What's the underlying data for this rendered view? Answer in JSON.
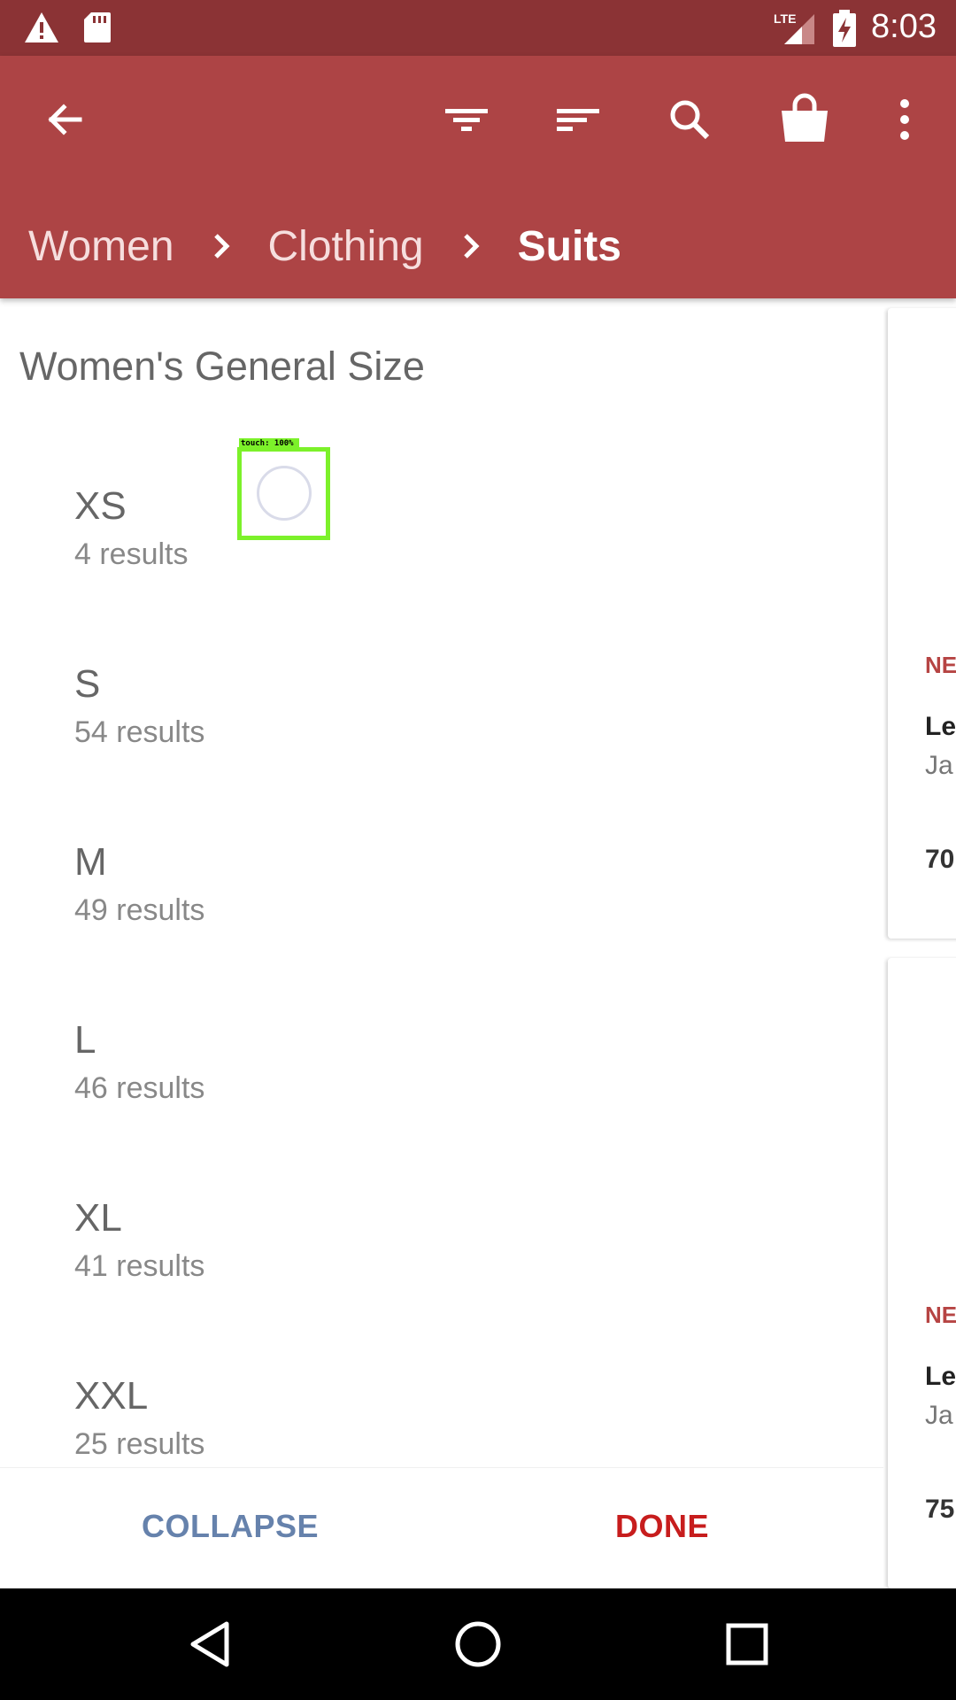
{
  "status_bar": {
    "time": "8:03",
    "network": "LTE",
    "icons": [
      "warning-icon",
      "sd-card-icon",
      "lte-signal-icon",
      "battery-charging-icon"
    ]
  },
  "toolbar": {
    "icons": [
      "back-arrow-icon",
      "filter-icon",
      "sort-icon",
      "search-icon",
      "shopping-bag-icon",
      "more-vert-icon"
    ]
  },
  "breadcrumb": {
    "items": [
      "Women",
      "Clothing",
      "Suits"
    ]
  },
  "filter_panel": {
    "title": "Women's General Size",
    "sizes": [
      {
        "label": "XS",
        "count": "4 results"
      },
      {
        "label": "S",
        "count": "54 results"
      },
      {
        "label": "M",
        "count": "49 results"
      },
      {
        "label": "L",
        "count": "46 results"
      },
      {
        "label": "XL",
        "count": "41 results"
      },
      {
        "label": "XXL",
        "count": "25 results"
      }
    ],
    "collapse_label": "COLLAPSE",
    "done_label": "DONE"
  },
  "touch_indicator": {
    "label": "touch: 100%"
  },
  "product_cards": [
    {
      "badge": "NE",
      "name": "Le",
      "brand": "Ja",
      "price": "70"
    },
    {
      "badge": "NE",
      "name": "Le",
      "brand": "Ja",
      "price": "75"
    }
  ],
  "colors": {
    "status_bar": "#8b3335",
    "app_bar": "#ad4445",
    "done": "#c71d1d",
    "collapse": "#6682ac",
    "touch_overlay": "#7cf12a"
  },
  "nav_bar": {
    "icons": [
      "back-triangle-icon",
      "home-circle-icon",
      "recents-square-icon"
    ]
  }
}
